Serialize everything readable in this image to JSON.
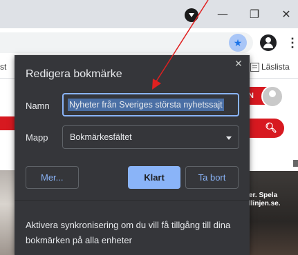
{
  "window": {
    "minimize": "—",
    "maximize": "❐",
    "close": "✕"
  },
  "toolbar": {
    "star_glyph": "★",
    "menu_glyph": "⋮"
  },
  "bookmarks_bar": {
    "left_fragment": "st",
    "reading_list": "Läslista"
  },
  "page": {
    "login_fragment": "N",
    "search_glyph": "🔍︎",
    "photo_caption": "er. Spela\nllinjen.se."
  },
  "dialog": {
    "title": "Redigera bokmärke",
    "close_glyph": "✕",
    "name_label": "Namn",
    "name_value": "Nyheter från Sveriges största nyhetssajt",
    "folder_label": "Mapp",
    "folder_value": "Bokmärkesfältet",
    "more_button": "Mer...",
    "done_button": "Klart",
    "remove_button": "Ta bort",
    "sync_text": "Aktivera synkronisering om du vill få tillgång till dina bokmärken på alla enheter"
  },
  "colors": {
    "dialog_bg": "#35363a",
    "accent": "#8ab4f8",
    "brand_red": "#d71920",
    "annotation": "#e02020"
  }
}
